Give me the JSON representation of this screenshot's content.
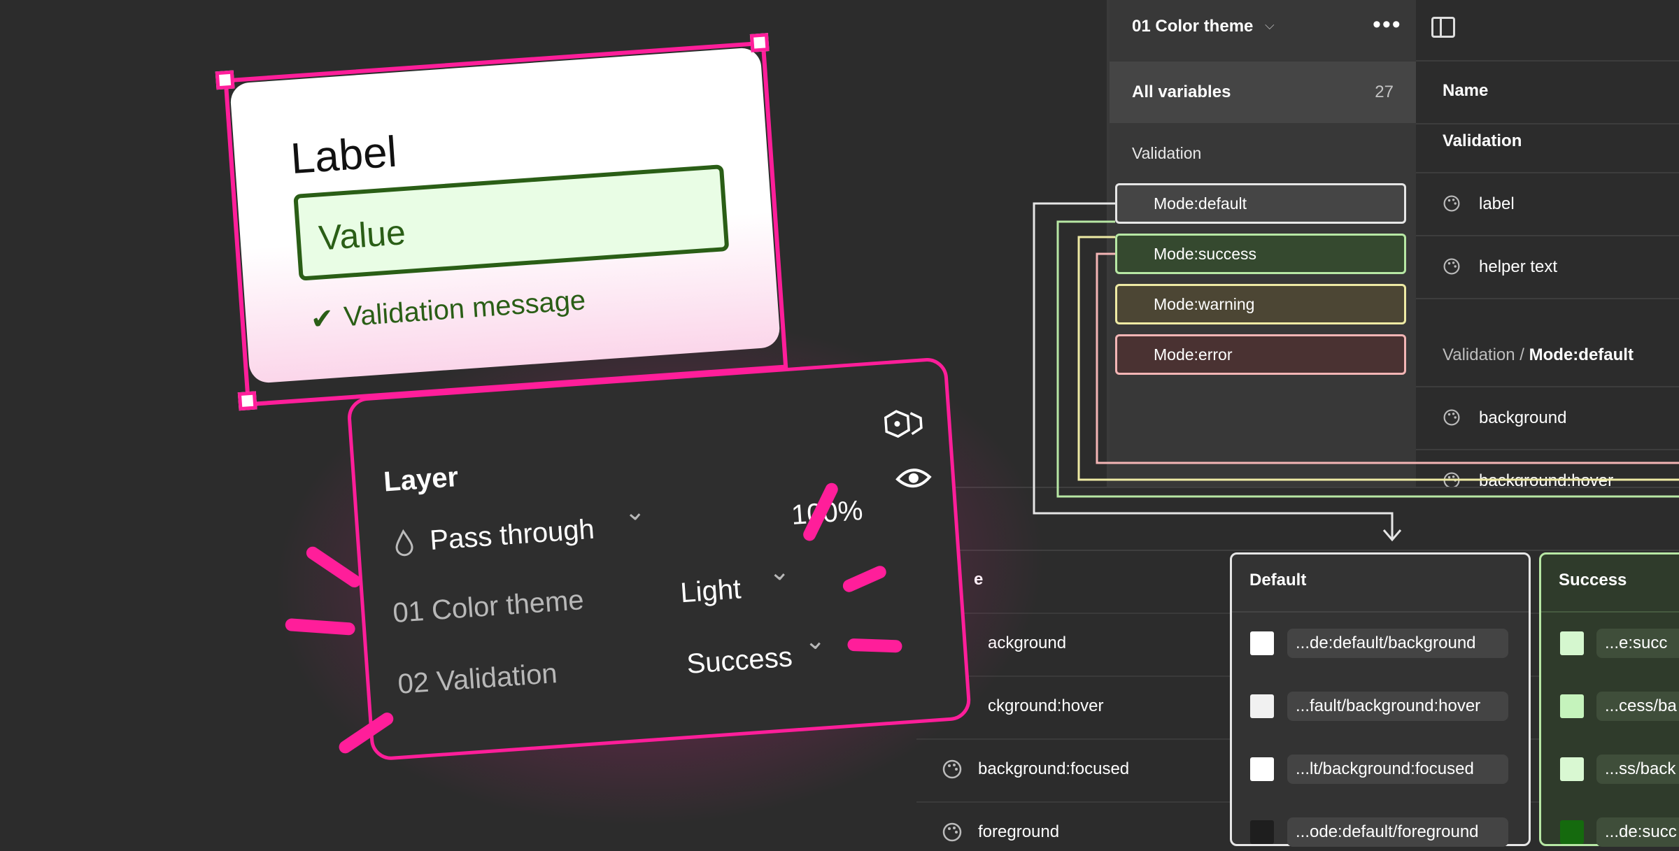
{
  "sidebar": {
    "collection_title": "01 Color theme",
    "chevron": "⌵",
    "more": "•••",
    "all_variables_label": "All variables",
    "all_variables_count": "27",
    "group_label": "Validation",
    "modes": [
      {
        "label": "Mode:default",
        "fill": "#454545",
        "border": "#e6e6e6"
      },
      {
        "label": "Mode:success",
        "fill": "#35492f",
        "border": "#b7e7a4"
      },
      {
        "label": "Mode:warning",
        "fill": "#4c4634",
        "border": "#eeeaa4"
      },
      {
        "label": "Mode:error",
        "fill": "#4a3232",
        "border": "#f3b5b5"
      }
    ]
  },
  "var_table": {
    "panel_icon": "panel-toggle-icon",
    "header_name": "Name",
    "group1": "Validation",
    "rows1": [
      "label",
      "helper text"
    ],
    "group2_prefix": "Validation / ",
    "group2_mode": "Mode:default",
    "rows2": [
      "background",
      "background:hover"
    ]
  },
  "bottom_table": {
    "name_header_partial": "e",
    "default_header": "Default",
    "success_header": "Success",
    "rows": [
      {
        "name": "ackground",
        "default_alias": "...de:default/background",
        "success_alias": "...e:succ",
        "default_swatch": "#ffffff",
        "success_swatch": "#d5f7cf"
      },
      {
        "name": "ckground:hover",
        "default_alias": "...fault/background:hover",
        "success_alias": "...cess/ba",
        "default_swatch": "#f1f1f1",
        "success_swatch": "#c5f3bc"
      },
      {
        "name": "background:focused",
        "default_alias": "...lt/background:focused",
        "success_alias": "...ss/back",
        "default_swatch": "#ffffff",
        "success_swatch": "#d9f8d2"
      },
      {
        "name": "foreground",
        "default_alias": "...ode:default/foreground",
        "success_alias": "...de:succ",
        "default_swatch": "#1e1e1e",
        "success_swatch": "#156a0e"
      }
    ]
  },
  "card": {
    "label": "Label",
    "value": "Value",
    "check": "✔",
    "message": "Validation message",
    "accent": "#ff1e9a",
    "success_color": "#2a5e16"
  },
  "layer_panel": {
    "title": "Layer",
    "blend_mode": "Pass through",
    "opacity": "100%",
    "rows": [
      {
        "name": "01 Color theme",
        "value": "Light"
      },
      {
        "name": "02 Validation",
        "value": "Success"
      }
    ],
    "chevron": "⌄"
  }
}
